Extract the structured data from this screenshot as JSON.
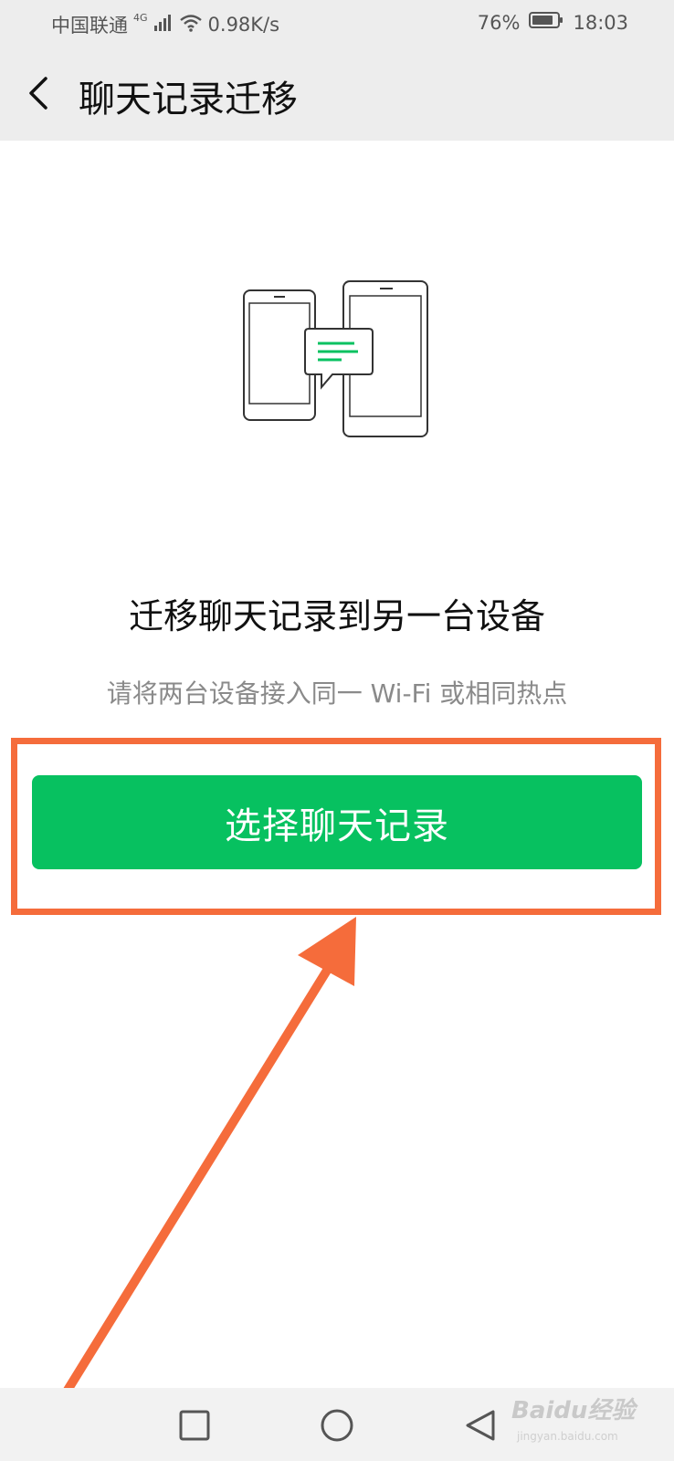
{
  "status_bar": {
    "carrier": "中国联通",
    "network_type": "4G",
    "speed": "0.98K/s",
    "battery": "76%",
    "time": "18:03"
  },
  "header": {
    "title": "聊天记录迁移"
  },
  "main": {
    "title": "迁移聊天记录到另一台设备",
    "subtitle": "请将两台设备接入同一 Wi-Fi 或相同热点",
    "button_label": "选择聊天记录"
  },
  "colors": {
    "accent_green": "#07c160",
    "annotation_orange": "#f56c3b",
    "header_bg": "#ededed"
  },
  "icons": [
    "back-arrow-icon",
    "signal-icon",
    "wifi-icon",
    "battery-icon",
    "phone-transfer-icon",
    "square-nav-icon",
    "circle-nav-icon",
    "triangle-back-nav-icon"
  ],
  "watermark": {
    "logo": "Baidu经验",
    "url": "jingyan.baidu.com"
  }
}
